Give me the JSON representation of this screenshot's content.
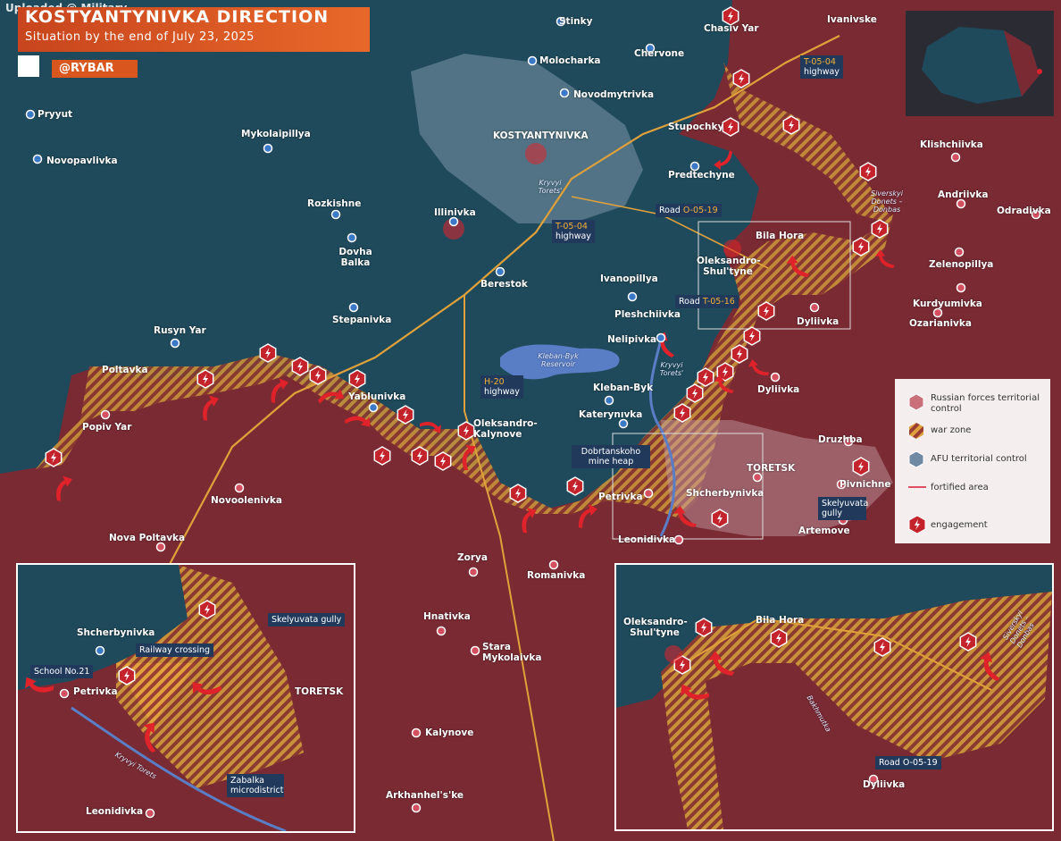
{
  "header": {
    "uploaded": "Uploaded @ Military.",
    "title": "KOSTYANTYNIVKA DIRECTION",
    "subtitle": "Situation by the end of July 23, 2025",
    "brand": "@RYBAR"
  },
  "legend": {
    "russian": "Russian forces territorial control",
    "war_zone": "war zone",
    "afu": "AFU territorial control",
    "fortified": "fortified area",
    "engagement": "engagement"
  },
  "colors": {
    "russian": "#7a2a33",
    "afu": "#1f4a5c",
    "war_zone": "#e0a13a",
    "fortified": "#e05060",
    "engagement": "#c4232b",
    "accent": "#e0601f"
  },
  "places": [
    {
      "name": "Stinky"
    },
    {
      "name": "Chasiv Yar"
    },
    {
      "name": "Ivanivske"
    },
    {
      "name": "Chervone"
    },
    {
      "name": "Molocharka"
    },
    {
      "name": "Novodmytrivka"
    },
    {
      "name": "Pryyut"
    },
    {
      "name": "Mykolaipillya"
    },
    {
      "name": "KOSTYANTYNIVKA"
    },
    {
      "name": "Stupochky"
    },
    {
      "name": "Klishchiivka"
    },
    {
      "name": "Novopavlivka"
    },
    {
      "name": "Predtechyne"
    },
    {
      "name": "Rozkishne"
    },
    {
      "name": "Illinivka"
    },
    {
      "name": "Andriivka"
    },
    {
      "name": "Odradivka"
    },
    {
      "name": "Bila Hora"
    },
    {
      "name": "Dovha Balka"
    },
    {
      "name": "Oleksandro-Shul'tyne"
    },
    {
      "name": "Berestok"
    },
    {
      "name": "Zelenopillya"
    },
    {
      "name": "Ivanopillya"
    },
    {
      "name": "Kurdyumivka"
    },
    {
      "name": "Stepanivka"
    },
    {
      "name": "Pleshchiivka"
    },
    {
      "name": "Ozarianivka"
    },
    {
      "name": "Dyliivka"
    },
    {
      "name": "Rusyn Yar"
    },
    {
      "name": "Nelipivka"
    },
    {
      "name": "Poltavka"
    },
    {
      "name": "Dyliivka"
    },
    {
      "name": "Kleban-Byk"
    },
    {
      "name": "Yablunivka"
    },
    {
      "name": "Popiv Yar"
    },
    {
      "name": "Katerynıvka"
    },
    {
      "name": "Oleksandro-Kalynove"
    },
    {
      "name": "Druzhba"
    },
    {
      "name": "TORETSK"
    },
    {
      "name": "Pivnichne"
    },
    {
      "name": "Novoolenivka"
    },
    {
      "name": "Petrivka"
    },
    {
      "name": "Shcherbynivka"
    },
    {
      "name": "Artemove"
    },
    {
      "name": "Leonidivka"
    },
    {
      "name": "Nova Poltavka"
    },
    {
      "name": "Zorya"
    },
    {
      "name": "Romanivka"
    },
    {
      "name": "Hnativka"
    },
    {
      "name": "Stara Mykolaivka"
    },
    {
      "name": "Kalynove"
    },
    {
      "name": "Arkhanhel's'ke"
    }
  ],
  "roads": {
    "t0504_top": "T-05-04",
    "t0504_top_2": "highway",
    "o0519": "O-05-19",
    "road_word": "Road",
    "t0504_mid": "T-05-04",
    "t0504_mid_2": "highway",
    "t0516": "T-05-16",
    "h20": "H-20",
    "h20_2": "highway",
    "mine": "Dobrtanskoho mine heap",
    "skelyuvata": "Skelyuvata gully"
  },
  "water": {
    "reservoir": "Kleban-Byk Reservoir",
    "kryvyi_torets": "Kryvyi Torets'",
    "kryvyi_torets2": "Kryvyi Torets'",
    "donets": "Siverskyi Donets – Donbas"
  },
  "inset_left": {
    "shcherbynivka": "Shcherbynivka",
    "railway": "Railway crossing",
    "school": "School No.21",
    "petrivka": "Petrivka",
    "toretsk": "TORETSK",
    "skelyuvata": "Skelyuvata gully",
    "zabalka": "Zabalka microdistrict",
    "kryvyi": "Kryvyi Torets",
    "leonidivka": "Leonidivka"
  },
  "inset_right": {
    "oleksandro": "Oleksandro-Shul'tyne",
    "bila_hora": "Bila Hora",
    "road": "Road O-05-19",
    "dyliivka": "Dyliivka",
    "donets": "Siverskyi Donets – Donbas",
    "bakhmutka": "Bakhmutka"
  }
}
